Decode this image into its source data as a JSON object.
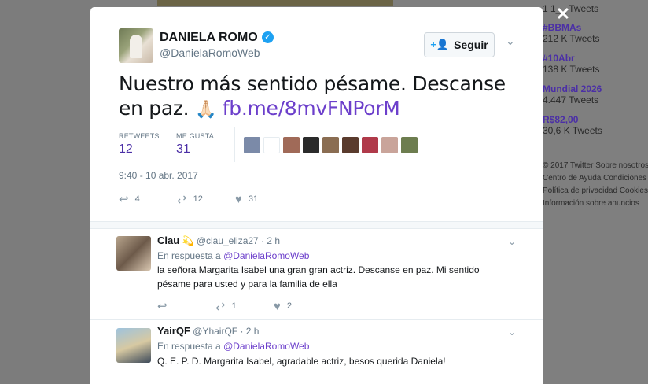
{
  "background": {
    "trends": [
      {
        "tag": "",
        "count": "1 1__ Tweets"
      },
      {
        "tag": "#BBMAs",
        "count": "212 K Tweets"
      },
      {
        "tag": "#10Abr",
        "count": "138 K Tweets"
      },
      {
        "tag": "Mundial 2026",
        "count": "4.447 Tweets"
      },
      {
        "tag": "R$82,00",
        "count": "30,6 K Tweets"
      }
    ],
    "footer": [
      "© 2017 Twitter   Sobre nosotros",
      "Centro de Ayuda   Condiciones",
      "Política de privacidad   Cookies",
      "Información sobre anuncios"
    ]
  },
  "close_icon": "✕",
  "tweet": {
    "name": "DANIELA ROMO",
    "handle": "@DanielaRomoWeb",
    "follow_label": "Seguir",
    "text": "Nuestro más sentido pésame. Descanse en paz.",
    "emoji": "🙏🏻",
    "link": "fb.me/8mvFNPorM",
    "retweets_label": "RETWEETS",
    "retweets": "12",
    "likes_label": "ME GUSTA",
    "likes": "31",
    "timestamp": "9:40 - 10 abr. 2017",
    "actions": {
      "reply": "4",
      "retweet": "12",
      "like": "31"
    }
  },
  "colors": {
    "accent": "#6c3fcb",
    "verified": "#1da1f2",
    "trend": "#4b2fa6"
  },
  "liker_faces": [
    "#7b8aa8",
    "#ffffff",
    "#a06a58",
    "#2b2b2b",
    "#8a6d52",
    "#5a3b2d",
    "#b03a4a",
    "#c9a49a",
    "#6d7d4f"
  ],
  "replies": [
    {
      "name": "Clau",
      "badge": "💫",
      "handle": "@clau_eliza27",
      "time": "· 2 h",
      "in_reply_prefix": "En respuesta a",
      "in_reply_to": "@DanielaRomoWeb",
      "text": "la señora Margarita Isabel una gran gran actriz. Descanse en paz. Mi sentido pésame para usted y para la familia de ella",
      "retweets": "1",
      "likes": "2"
    },
    {
      "name": "YairQF",
      "handle": "@YhairQF",
      "time": "· 2 h",
      "in_reply_prefix": "En respuesta a",
      "in_reply_to": "@DanielaRomoWeb",
      "text": "Q. E. P. D. Margarita Isabel, agradable actriz, besos querida Daniela!",
      "retweets": "",
      "likes": ""
    }
  ]
}
